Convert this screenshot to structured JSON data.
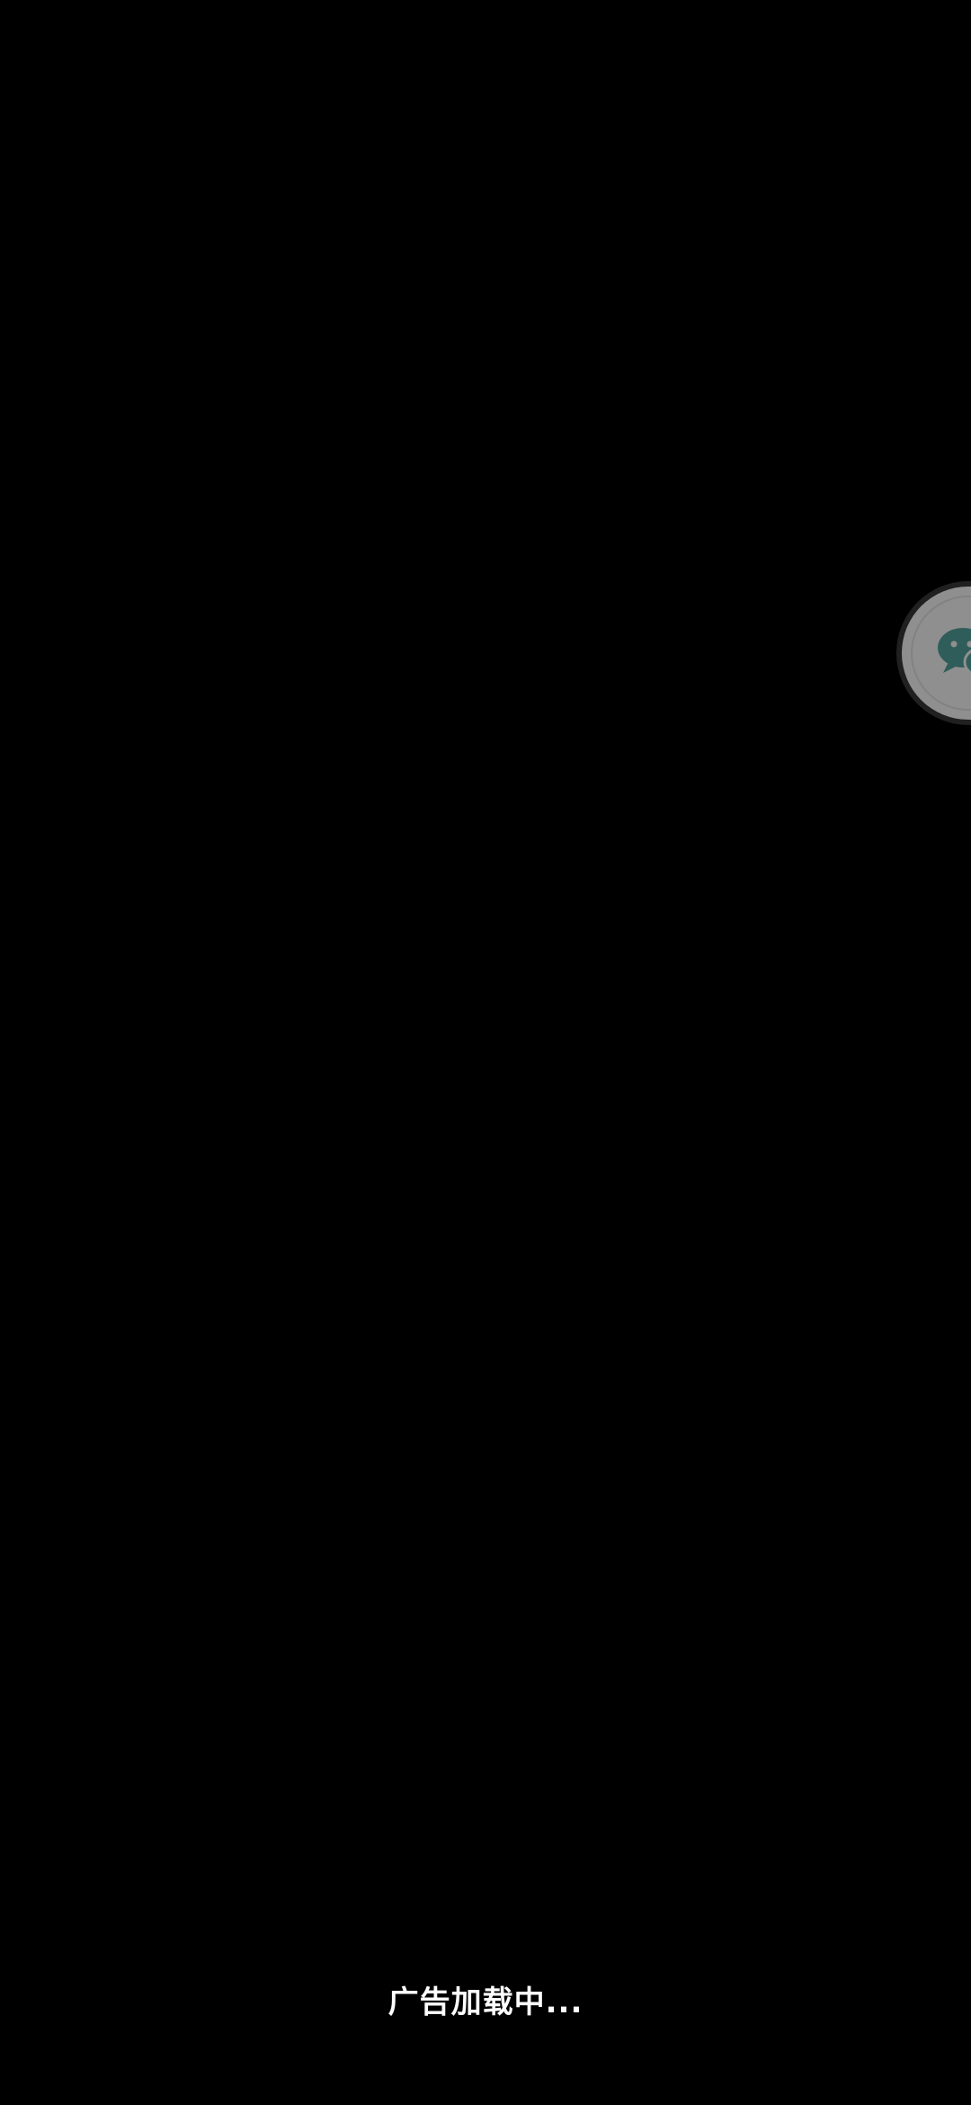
{
  "floating_button": {
    "icon": "wechat-chat-icon",
    "background_color": "#8f8f8f",
    "icon_color": "#2f5d5a"
  },
  "loading": {
    "text": "广告加载中..."
  },
  "colors": {
    "background": "#000000",
    "text": "#ffffff"
  }
}
